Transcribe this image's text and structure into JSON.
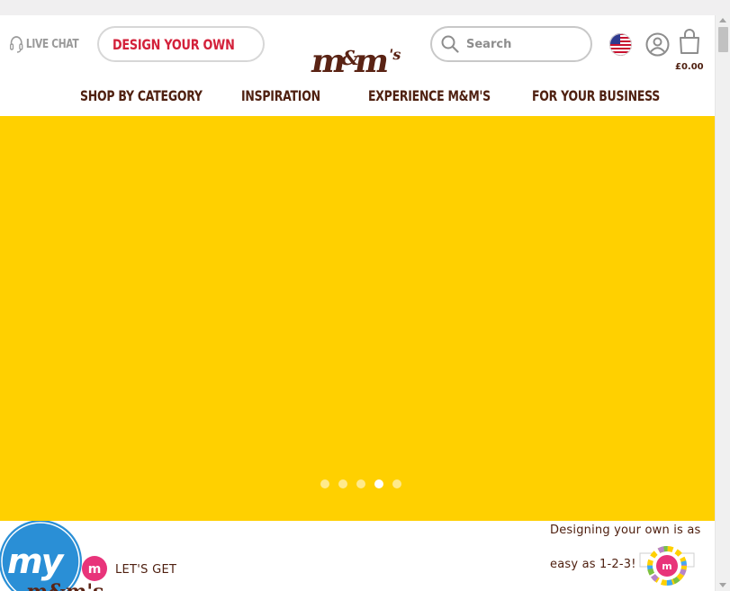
{
  "header": {
    "live_chat_label": "LIVE CHAT",
    "design_button_label": "DESIGN YOUR OWN",
    "logo_text": "m&m's",
    "search_placeholder": "Search",
    "cart_total": "£0.00",
    "icons": [
      "headset-icon",
      "design-wheel-icon",
      "search-icon",
      "us-flag-icon",
      "account-icon",
      "shopping-bag-icon"
    ]
  },
  "nav": {
    "items": [
      {
        "label": "SHOP BY CATEGORY"
      },
      {
        "label": "INSPIRATION"
      },
      {
        "label": "EXPERIENCE M&M'S"
      },
      {
        "label": "FOR YOUR BUSINESS"
      }
    ]
  },
  "hero": {
    "background_color": "#ffd000",
    "carousel_slide_count": 5,
    "carousel_active_index": 4
  },
  "promo": {
    "mym_logo_text": "my m&m's",
    "lets_get_text": "LET'S GET",
    "line1": "Designing your own is as",
    "line2": "easy as 1-2-3!"
  },
  "colors": {
    "brand_red": "#d3213a",
    "brand_brown": "#4f2010",
    "hero_yellow": "#ffd000"
  }
}
